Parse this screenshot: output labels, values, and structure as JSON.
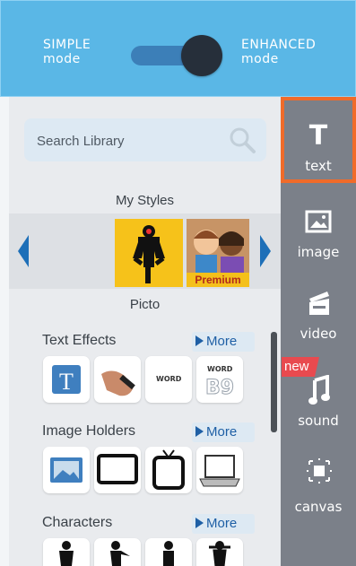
{
  "mode_toggle": {
    "left_line1": "SIMPLE",
    "left_line2": "mode",
    "right_line1": "ENHANCED",
    "right_line2": "mode",
    "state": "enhanced"
  },
  "search": {
    "placeholder": "Search Library"
  },
  "styles": {
    "heading": "My Styles",
    "selected_label": "Picto",
    "premium_label": "Premium"
  },
  "categories": {
    "text_effects": {
      "title": "Text Effects",
      "more": "More",
      "word1": "WORD",
      "word2": "WORD"
    },
    "image_holders": {
      "title": "Image Holders",
      "more": "More"
    },
    "characters": {
      "title": "Characters",
      "more": "More"
    }
  },
  "tools": {
    "text": "text",
    "text_glyph": "T",
    "image": "image",
    "video": "video",
    "sound": "sound",
    "canvas": "canvas",
    "new_badge": "new"
  },
  "colors": {
    "topbar": "#5ab7e6",
    "tool_sidebar": "#7b8089",
    "active_tool_border": "#f06b2a",
    "new_badge": "#e84a4f",
    "link_blue": "#1e5fa5"
  },
  "icons": [
    "search-icon",
    "image-icon",
    "video-icon",
    "music-note-icon",
    "canvas-icon"
  ]
}
